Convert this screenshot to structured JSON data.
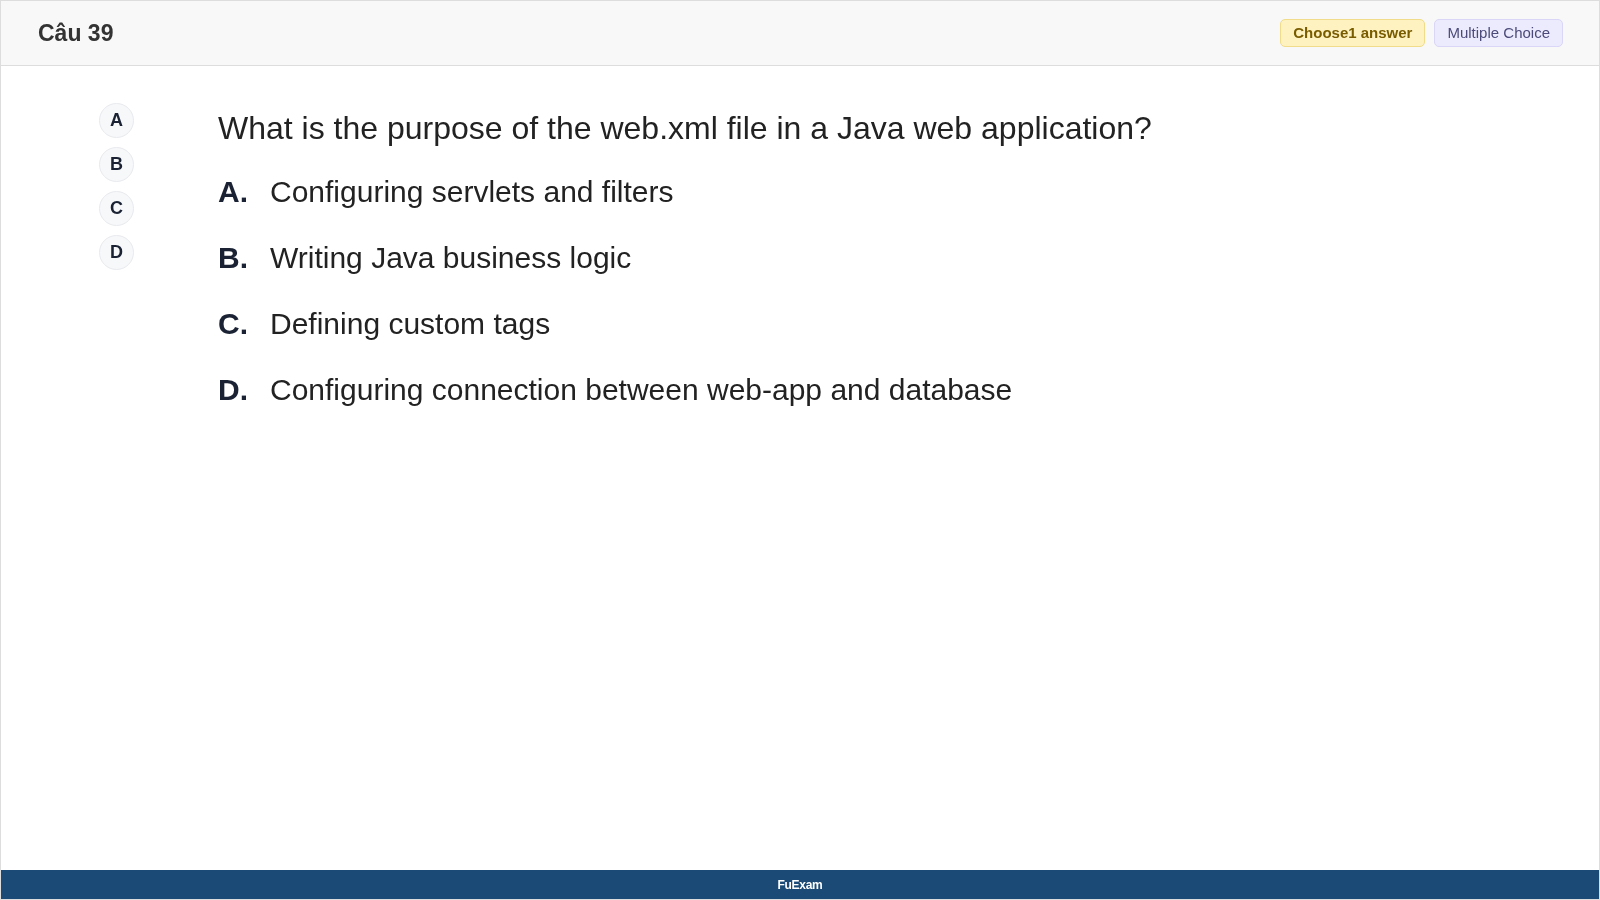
{
  "header": {
    "title": "Câu 39",
    "badges": [
      {
        "kind": "count",
        "label": "Choose1 answer"
      },
      {
        "kind": "type",
        "label": "Multiple Choice"
      }
    ]
  },
  "answer_buttons": [
    "A",
    "B",
    "C",
    "D"
  ],
  "question": "What is the purpose of the web.xml file in a Java web application?",
  "options": [
    {
      "letter": "A.",
      "text": "Configuring servlets and filters"
    },
    {
      "letter": "B.",
      "text": "Writing Java business logic"
    },
    {
      "letter": "C.",
      "text": "Defining custom tags"
    },
    {
      "letter": "D.",
      "text": "Configuring connection between web-app and database"
    }
  ],
  "footer": "FuExam"
}
